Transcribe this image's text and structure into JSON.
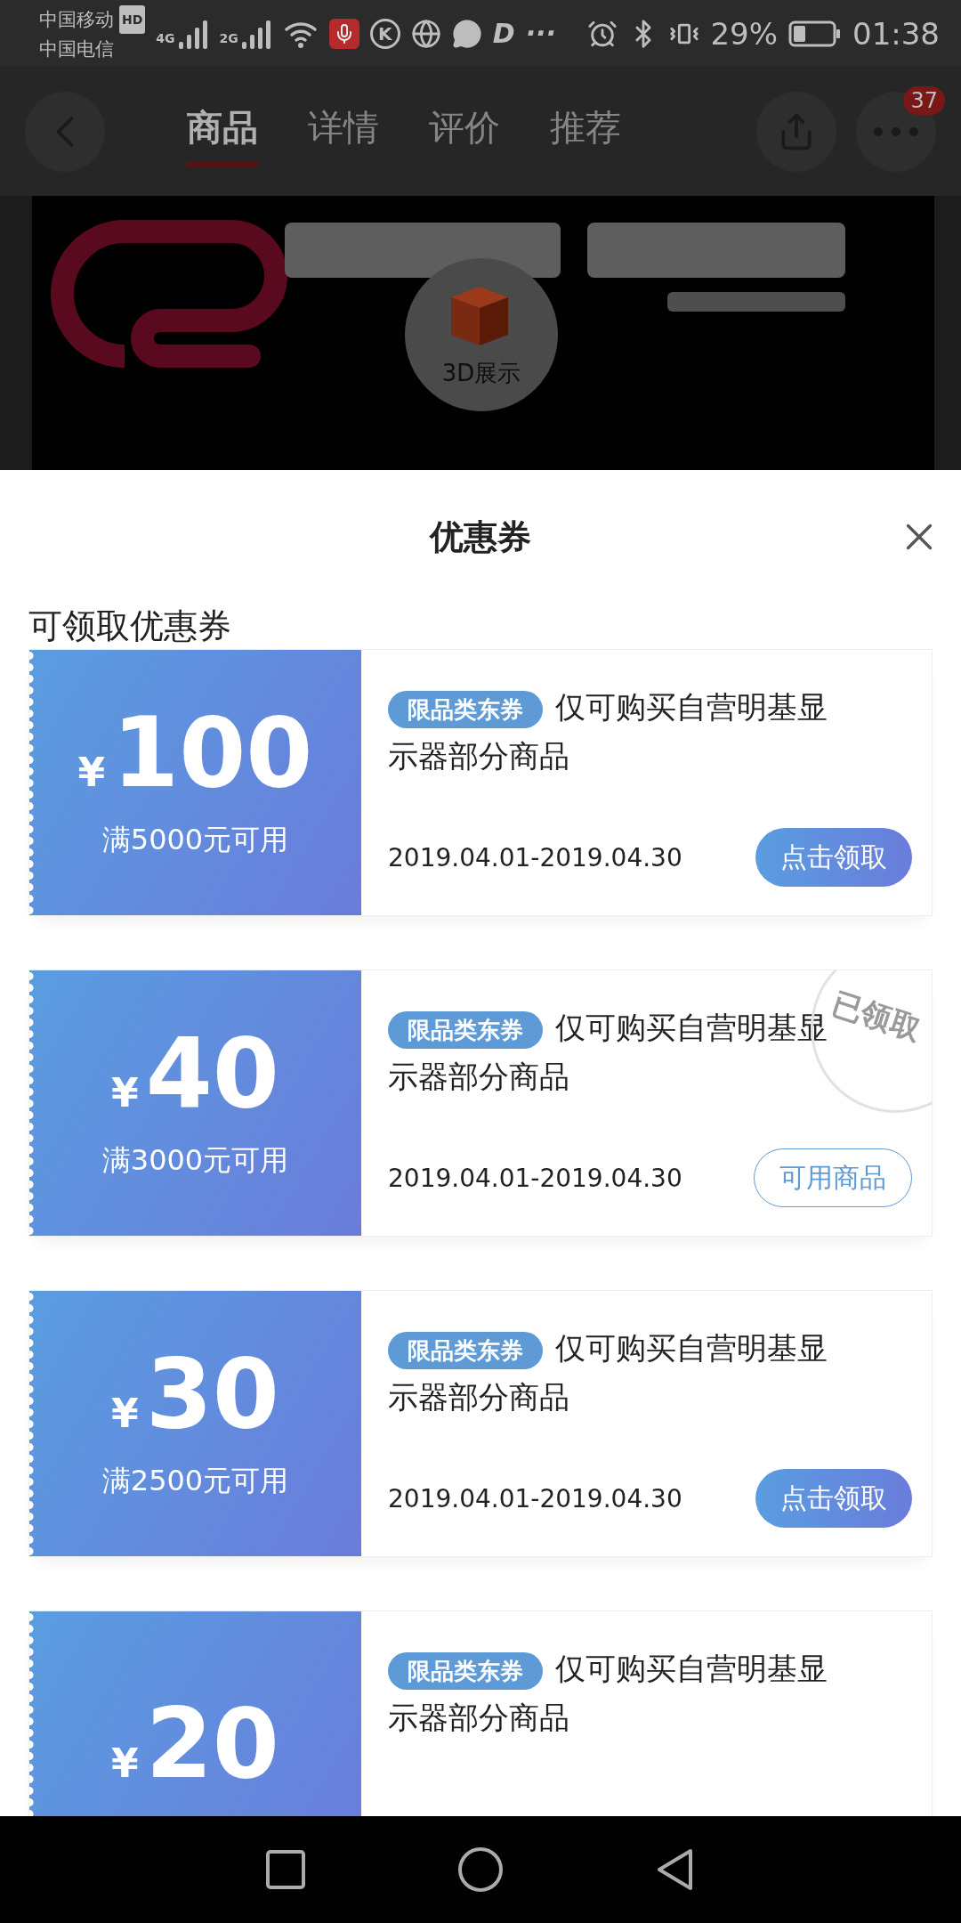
{
  "status_bar": {
    "carriers": [
      "中国移动",
      "中国电信"
    ],
    "hd_badge": "HD",
    "networks": [
      {
        "label": "4G"
      },
      {
        "label": "2G"
      }
    ],
    "notifications": [
      {
        "kind": "mic"
      },
      {
        "kind": "glyph",
        "label": "K"
      },
      {
        "kind": "globe"
      },
      {
        "kind": "chat"
      },
      {
        "kind": "text",
        "label": "D"
      },
      {
        "kind": "text",
        "label": "···"
      }
    ],
    "battery": "29%",
    "time": "01:38"
  },
  "header": {
    "tabs": [
      {
        "label": "商品",
        "selected": true
      },
      {
        "label": "详情",
        "selected": false
      },
      {
        "label": "评价",
        "selected": false
      },
      {
        "label": "推荐",
        "selected": false
      }
    ],
    "badge": "37"
  },
  "banner": {
    "kind": "picture",
    "button": "3D展示"
  },
  "sheet": {
    "title": "优惠券",
    "section_title": "可领取优惠券",
    "coupons": [
      {
        "currency": "¥",
        "amount": "100",
        "condition": "满5000元可用",
        "tag": "限品类东券",
        "description": "仅可购买自营明基显示器部分商品",
        "date": "2019.04.01-2019.04.30",
        "button": {
          "kind": "claim",
          "label": "点击领取"
        }
      },
      {
        "currency": "¥",
        "amount": "40",
        "condition": "满3000元可用",
        "tag": "限品类东券",
        "description": "仅可购买自营明基显示器部分商品",
        "date": "2019.04.01-2019.04.30",
        "button": {
          "kind": "outline",
          "label": "可用商品"
        },
        "stamp": "已领取"
      },
      {
        "currency": "¥",
        "amount": "30",
        "condition": "满2500元可用",
        "tag": "限品类东券",
        "description": "仅可购买自营明基显示器部分商品",
        "date": "2019.04.01-2019.04.30",
        "button": {
          "kind": "claim",
          "label": "点击领取"
        }
      },
      {
        "currency": "¥",
        "amount": "20",
        "tag": "限品类东券",
        "description": "仅可购买自营明基显示器部分商品"
      }
    ]
  }
}
